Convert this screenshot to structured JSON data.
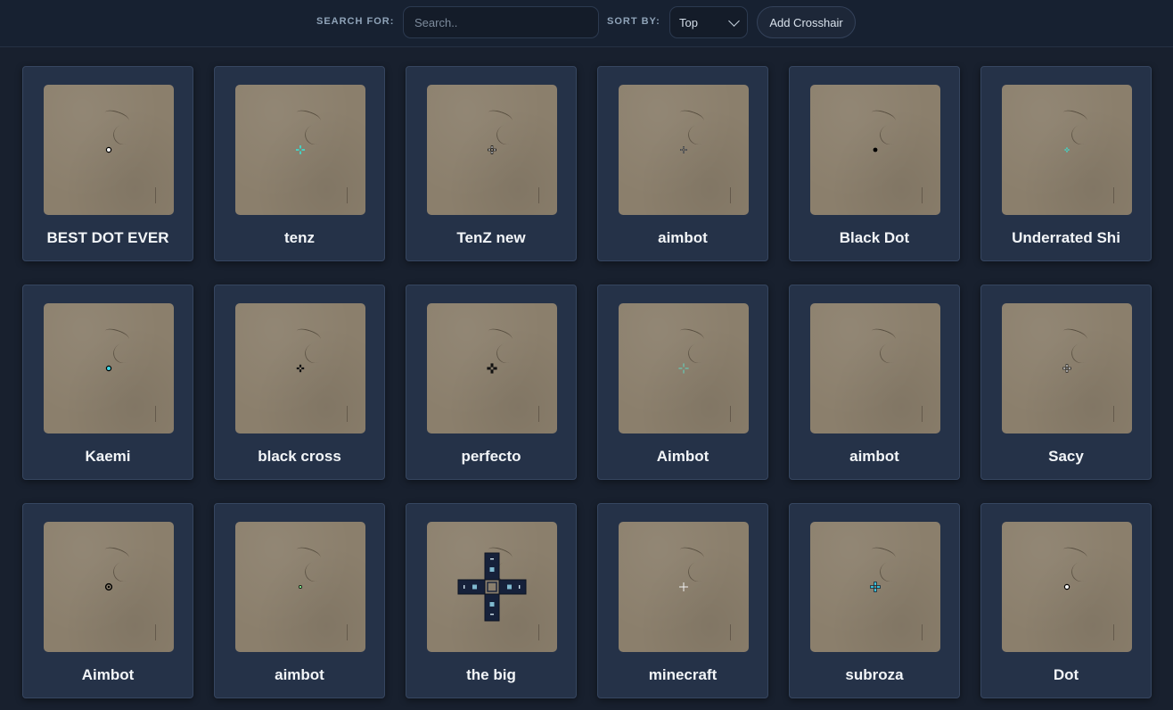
{
  "toolbar": {
    "search_label": "SEARCH FOR:",
    "search_placeholder": "Search..",
    "search_value": "",
    "sort_label": "SORT BY:",
    "sort_value": "Top",
    "add_label": "Add Crosshair"
  },
  "crosshairs": [
    {
      "name": "BEST DOT EVER",
      "style": "dot-white-outline"
    },
    {
      "name": "tenz",
      "style": "cross-cyan"
    },
    {
      "name": "TenZ new",
      "style": "cross-black-small"
    },
    {
      "name": "aimbot",
      "style": "cross-white-tiny"
    },
    {
      "name": "Black Dot",
      "style": "dot-black"
    },
    {
      "name": "Underrated Shi",
      "style": "cross-cyan-tiny"
    },
    {
      "name": "Kaemi",
      "style": "dot-cyan-outline"
    },
    {
      "name": "black cross",
      "style": "cross-black"
    },
    {
      "name": "perfecto",
      "style": "cross-black-bold"
    },
    {
      "name": "Aimbot",
      "style": "cross-teal-thin"
    },
    {
      "name": "aimbot",
      "style": "none"
    },
    {
      "name": "Sacy",
      "style": "cross-white-outline"
    },
    {
      "name": "Aimbot",
      "style": "dot-ring-black"
    },
    {
      "name": "aimbot",
      "style": "dot-green-tiny"
    },
    {
      "name": "the big",
      "style": "cross-giant"
    },
    {
      "name": "minecraft",
      "style": "plus-white"
    },
    {
      "name": "subroza",
      "style": "cross-cyan-bold"
    },
    {
      "name": "Dot",
      "style": "dot-white-outline"
    }
  ]
}
